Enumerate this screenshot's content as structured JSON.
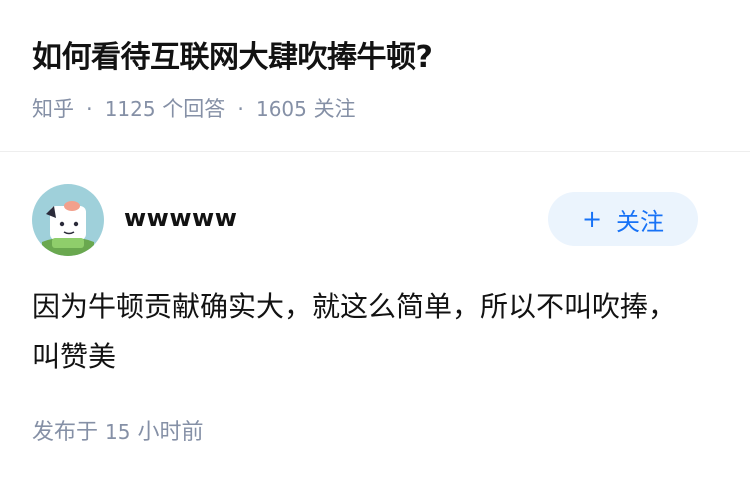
{
  "question": {
    "title": "如何看待互联网大肆吹捧牛顿?",
    "source": "知乎",
    "answer_count": "1125",
    "answer_unit": "个回答",
    "follower_count": "1605",
    "follower_unit": "关注"
  },
  "answer": {
    "author": "wwwww",
    "follow_label": "关注",
    "follow_icon": "plus-icon",
    "content": "因为牛顿贡献确实大，就这么简单，所以不叫吹捧，叫赞美",
    "published_prefix": "发布于",
    "published_value": "15",
    "published_unit": "小时前"
  },
  "colors": {
    "meta_gray": "#8590a6",
    "accent_blue": "#1772f6",
    "follow_bg": "#ebf4fd",
    "avatar_bg": "#9fd0da"
  }
}
